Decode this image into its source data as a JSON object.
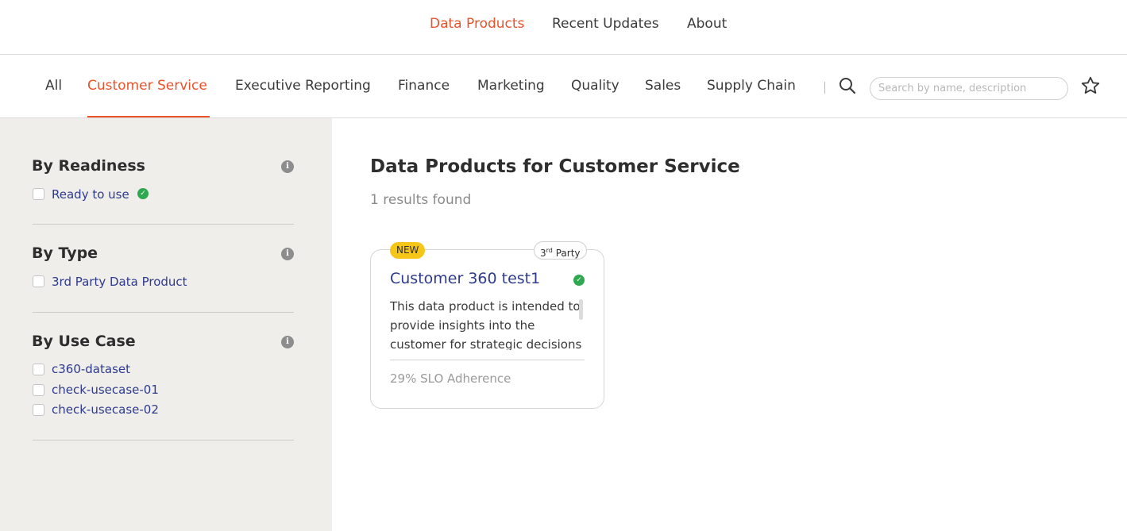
{
  "top_nav": {
    "links": [
      {
        "label": "Data Products",
        "active": true
      },
      {
        "label": "Recent Updates",
        "active": false
      },
      {
        "label": "About",
        "active": false
      }
    ]
  },
  "categories": {
    "tabs": [
      {
        "label": "All",
        "active": false
      },
      {
        "label": "Customer Service",
        "active": true
      },
      {
        "label": "Executive Reporting",
        "active": false
      },
      {
        "label": "Finance",
        "active": false
      },
      {
        "label": "Marketing",
        "active": false
      },
      {
        "label": "Quality",
        "active": false
      },
      {
        "label": "Sales",
        "active": false
      },
      {
        "label": "Supply Chain",
        "active": false
      }
    ],
    "search": {
      "placeholder": "Search by name, description",
      "value": ""
    },
    "icons": {
      "search": "search-icon",
      "favorite": "star-icon"
    }
  },
  "filters": {
    "readiness": {
      "title": "By Readiness",
      "options": [
        {
          "label": "Ready to use",
          "checked": false,
          "verified_icon": "check-circle-icon"
        }
      ]
    },
    "type": {
      "title": "By Type",
      "options": [
        {
          "label": "3rd Party Data Product",
          "checked": false
        }
      ]
    },
    "use_case": {
      "title": "By Use Case",
      "options": [
        {
          "label": "c360-dataset",
          "checked": false
        },
        {
          "label": "check-usecase-01",
          "checked": false
        },
        {
          "label": "check-usecase-02",
          "checked": false
        }
      ]
    },
    "info_icon_glyph": "i"
  },
  "main": {
    "title": "Data Products for Customer Service",
    "results_text": "1 results found",
    "cards": [
      {
        "badge_new": "NEW",
        "badge_party_num": "3",
        "badge_party_sup": "rd",
        "badge_party_text": "Party",
        "title": "Customer 360 test1",
        "description": "This data product is intended to provide insights into the customer for strategic decisions",
        "slo": "29% SLO Adherence"
      }
    ]
  },
  "colors": {
    "accent": "#e8532a",
    "link": "#2e3a8c",
    "verified": "#2fa84f",
    "sidebar_bg": "#efeeeb",
    "badge_new": "#f5c518"
  }
}
